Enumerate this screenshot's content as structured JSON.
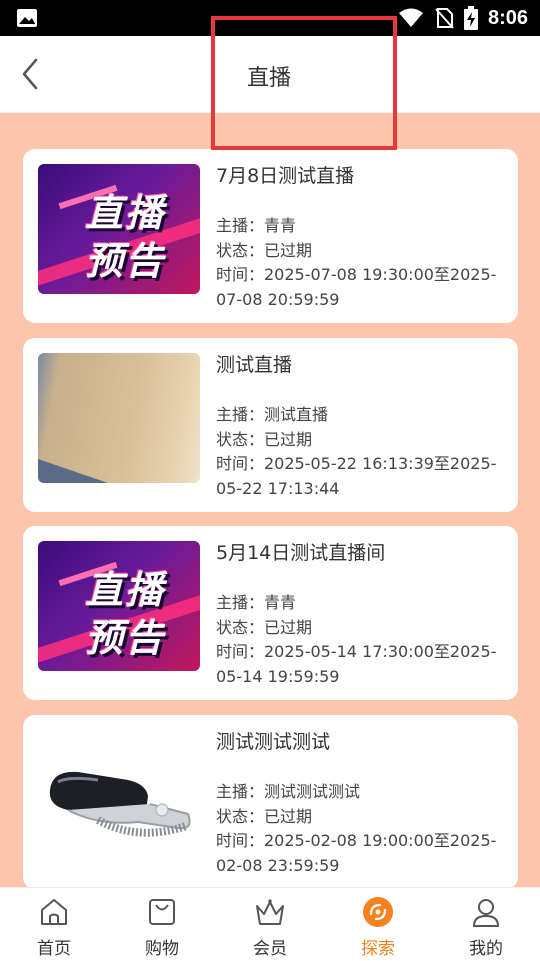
{
  "status_bar": {
    "time": "8:06"
  },
  "header": {
    "title": "直播",
    "back_icon": "chevron-left-icon"
  },
  "colors": {
    "page_bg": "#fdc5ab",
    "accent": "#f5821f",
    "highlight": "#e5383b"
  },
  "lives": [
    {
      "thumbnail": "promo-poster",
      "promo_line1": "直播",
      "promo_line2": "预告",
      "name": "7月8日测试直播",
      "host": "主播：青青",
      "status": "状态：已过期",
      "time": "时间：2025-07-08 19:30:00至2025-07-08 20:59:59"
    },
    {
      "thumbnail": "wall-photo",
      "name": "测试直播",
      "host": "主播：测试直播",
      "status": "状态：已过期",
      "time": "时间：2025-05-22 16:13:39至2025-05-22 17:13:44"
    },
    {
      "thumbnail": "promo-poster",
      "promo_line1": "直播",
      "promo_line2": "预告",
      "name": "5月14日测试直播间",
      "host": "主播：青青",
      "status": "状态：已过期",
      "time": "时间：2025-05-14 17:30:00至2025-05-14 19:59:59"
    },
    {
      "thumbnail": "vr-headset-photo",
      "name": "测试测试测试",
      "host": "主播：测试测试测试",
      "status": "状态：已过期",
      "time": "时间：2025-02-08 19:00:00至2025-02-08 23:59:59"
    }
  ],
  "tabbar": [
    {
      "label": "首页",
      "icon": "home-icon",
      "active": false
    },
    {
      "label": "购物",
      "icon": "shopping-bag-icon",
      "active": false
    },
    {
      "label": "会员",
      "icon": "crown-icon",
      "active": false
    },
    {
      "label": "探索",
      "icon": "explore-icon",
      "active": true
    },
    {
      "label": "我的",
      "icon": "user-icon",
      "active": false
    }
  ]
}
